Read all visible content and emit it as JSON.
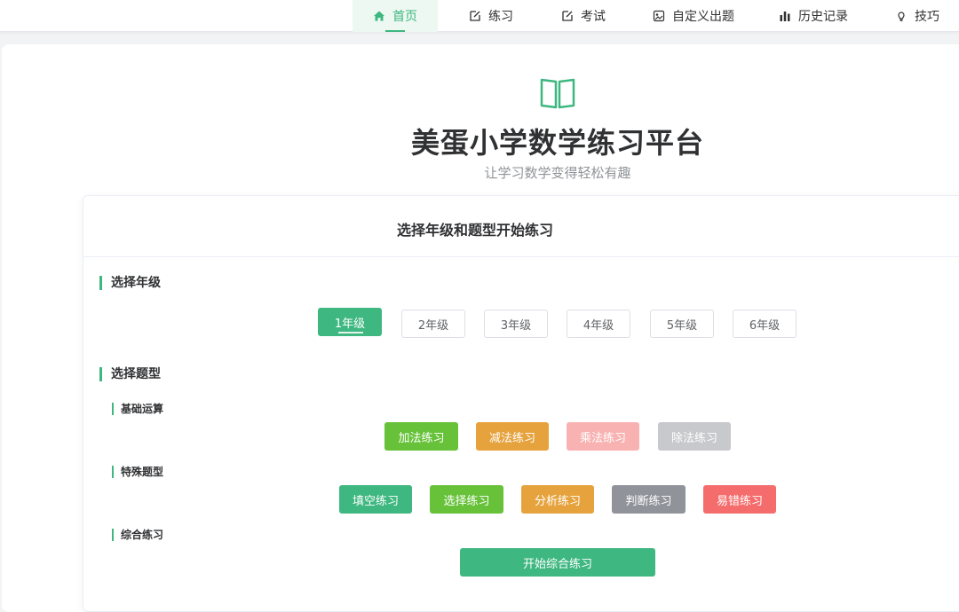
{
  "nav": {
    "items": [
      {
        "label": "首页",
        "icon": "home-icon",
        "active": true
      },
      {
        "label": "练习",
        "icon": "edit-icon"
      },
      {
        "label": "考试",
        "icon": "edit-icon"
      },
      {
        "label": "自定义出题",
        "icon": "custom-icon"
      },
      {
        "label": "历史记录",
        "icon": "chart-bar-icon"
      },
      {
        "label": "技巧",
        "icon": "bulb-icon"
      }
    ]
  },
  "hero": {
    "icon": "open-book-icon",
    "title": "美蛋小学数学练习平台",
    "subtitle": "让学习数学变得轻松有趣"
  },
  "card": {
    "title": "选择年级和题型开始练习",
    "grade_section": "选择年级",
    "grades": [
      "1年级",
      "2年级",
      "3年级",
      "4年级",
      "5年级",
      "6年级"
    ],
    "selected_grade": "1年级",
    "type_section": "选择题型",
    "basic": {
      "label": "基础运算",
      "buttons": [
        "加法练习",
        "减法练习",
        "乘法练习",
        "除法练习"
      ]
    },
    "special": {
      "label": "特殊题型",
      "buttons": [
        "填空练习",
        "选择练习",
        "分析练习",
        "判断练习",
        "易错练习"
      ]
    },
    "comprehensive": {
      "label": "综合练习",
      "button": "开始综合练习"
    }
  },
  "colors": {
    "primary": "#3eb780",
    "success": "#67c23a",
    "warning": "#e6a23c",
    "danger_light": "#f9b2b2",
    "disabled": "#c8c9cc",
    "info": "#909399",
    "danger": "#f56c6c"
  }
}
